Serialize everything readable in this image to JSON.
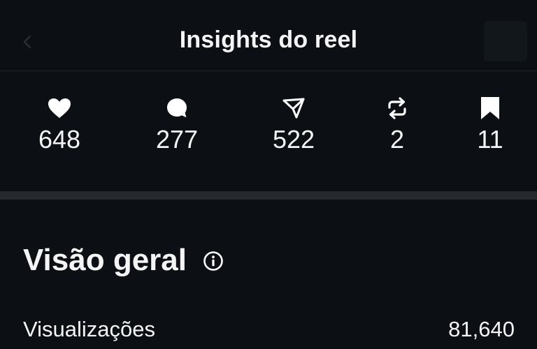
{
  "header": {
    "title": "Insights do reel"
  },
  "stats": [
    {
      "icon": "heart-icon",
      "value": "648"
    },
    {
      "icon": "comment-icon",
      "value": "277"
    },
    {
      "icon": "send-icon",
      "value": "522"
    },
    {
      "icon": "repost-icon",
      "value": "2"
    },
    {
      "icon": "bookmark-icon",
      "value": "11"
    }
  ],
  "overview": {
    "title": "Visão geral",
    "rows": [
      {
        "label": "Visualizações",
        "value": "81,640"
      }
    ]
  },
  "colors": {
    "background": "#0c1014",
    "divider": "#25292d",
    "text": "#f5f5f5"
  }
}
